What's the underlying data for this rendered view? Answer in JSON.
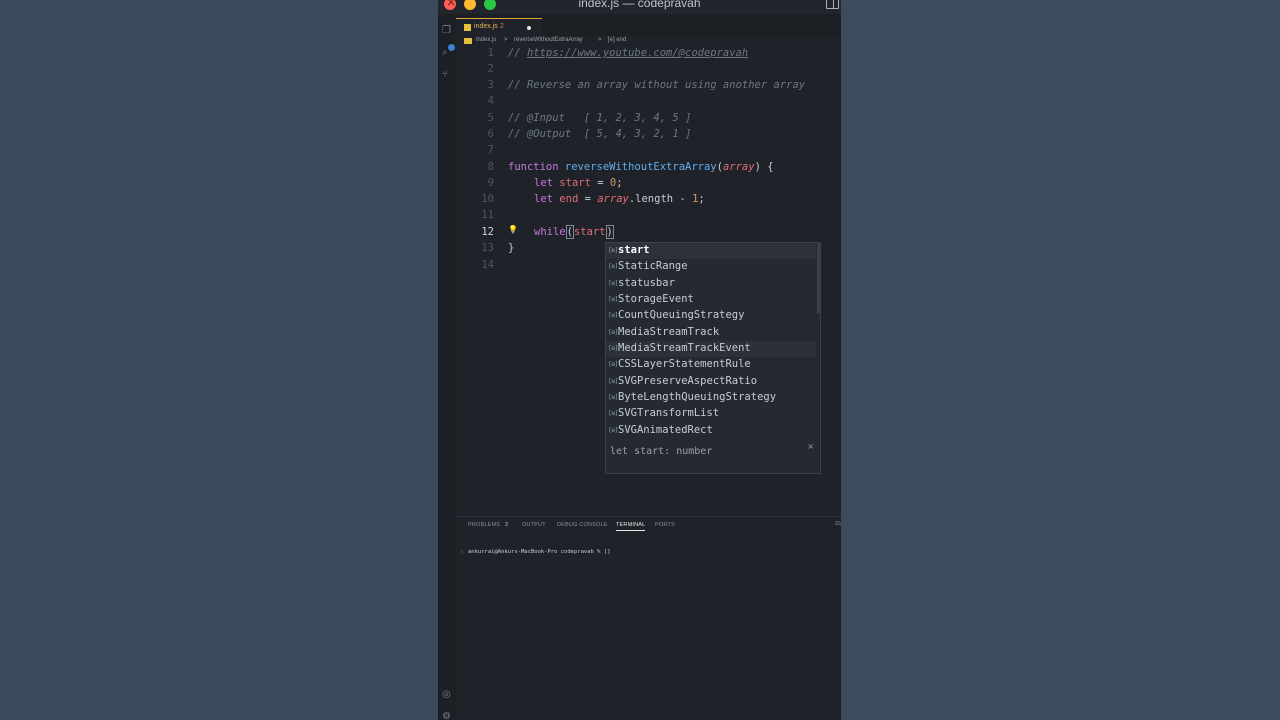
{
  "window": {
    "title": "index.js — codepravah"
  },
  "tab": {
    "label": "index.js",
    "count": "2"
  },
  "breadcrumb": {
    "file": "index.js",
    "sep1": ">",
    "func": "reverseWithoutExtraArray",
    "sep2": ">",
    "var": "[e] end"
  },
  "activity_badge": "",
  "code": {
    "line_numbers": [
      "1",
      "2",
      "3",
      "4",
      "5",
      "6",
      "7",
      "8",
      "9",
      "10",
      "11",
      "12",
      "13",
      "14"
    ],
    "l1_comment": "// ",
    "l1_url": "https://www.youtube.com/@codepravah",
    "l3": "// Reverse an array without using another array",
    "l5": "// @Input   [ 1, 2, 3, 4, 5 ]",
    "l6": "// @Output  [ 5, 4, 3, 2, 1 ]",
    "l8_kw": "function",
    "l8_fn": "reverseWithoutExtraArray",
    "l8_open": "(",
    "l8_param": "array",
    "l8_close": ") {",
    "l9_kw": "let",
    "l9_var": "start",
    "l9_eq": " = ",
    "l9_num": "0",
    "l9_semi": ";",
    "l10_kw": "let",
    "l10_var": "end",
    "l10_eq": " = ",
    "l10_obj": "array",
    "l10_prop": ".length - ",
    "l10_num": "1",
    "l10_semi": ";",
    "l12_kw": "while",
    "l12_open": "(",
    "l12_var": "start",
    "l12_close": ")",
    "l13": "}"
  },
  "suggestions": {
    "items": [
      {
        "label": "start"
      },
      {
        "label": "StaticRange"
      },
      {
        "label": "statusbar"
      },
      {
        "label": "StorageEvent"
      },
      {
        "label": "CountQueuingStrategy"
      },
      {
        "label": "MediaStreamTrack"
      },
      {
        "label": "MediaStreamTrackEvent"
      },
      {
        "label": "CSSLayerStatementRule"
      },
      {
        "label": "SVGPreserveAspectRatio"
      },
      {
        "label": "ByteLengthQueuingStrategy"
      },
      {
        "label": "SVGTransformList"
      },
      {
        "label": "SVGAnimatedRect"
      }
    ],
    "detail": "let start: number",
    "close": "×"
  },
  "panel": {
    "tabs": [
      "PROBLEMS",
      "OUTPUT",
      "DEBUG CONSOLE",
      "TERMINAL",
      "PORTS"
    ],
    "problems_count": "2",
    "active_tab": "TERMINAL",
    "right_label": "zs",
    "terminal_circle": "○",
    "terminal_prompt": "ankurrai@Ankurs-MacBook-Pro codepravah % []"
  }
}
